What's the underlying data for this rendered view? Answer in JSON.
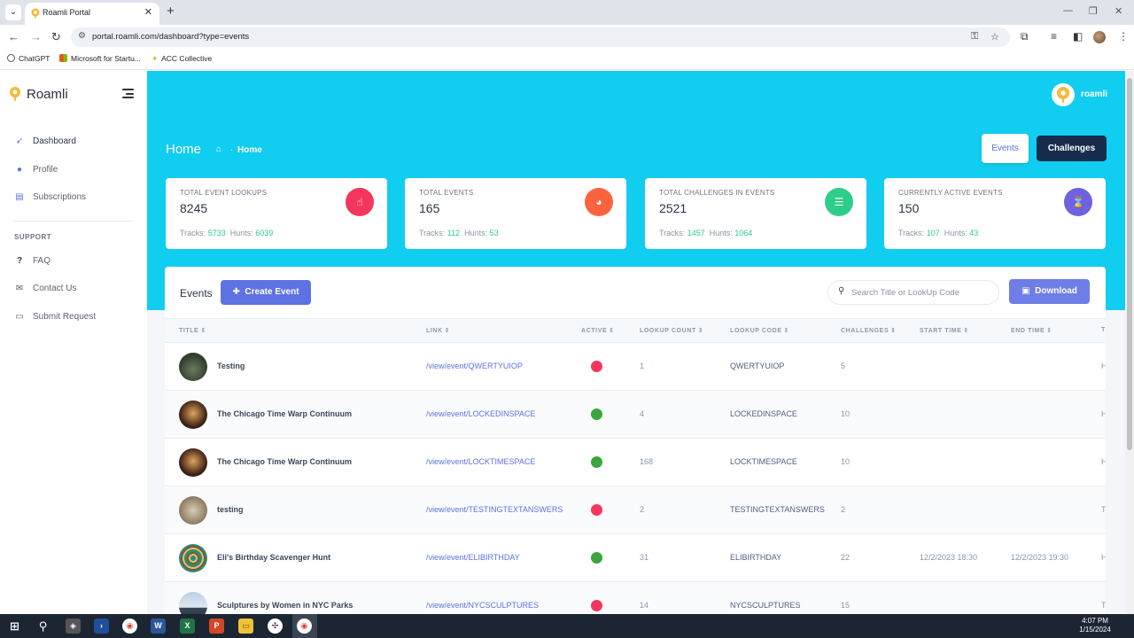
{
  "browser": {
    "tab_title": "Roamli Portal",
    "url": "portal.roamli.com/dashboard?type=events",
    "bookmarks": [
      "ChatGPT",
      "Microsoft for Startu...",
      "ACC Collective"
    ]
  },
  "sidebar": {
    "brand": "Roamli",
    "items": [
      {
        "label": "Dashboard",
        "icon": "rocket-icon"
      },
      {
        "label": "Profile",
        "icon": "user-icon"
      },
      {
        "label": "Subscriptions",
        "icon": "store-icon"
      }
    ],
    "support_heading": "SUPPORT",
    "support_items": [
      {
        "label": "FAQ",
        "icon": "question-icon"
      },
      {
        "label": "Contact Us",
        "icon": "envelope-icon"
      },
      {
        "label": "Submit Request",
        "icon": "chat-icon"
      }
    ]
  },
  "header": {
    "user_name": "roamli",
    "title": "Home",
    "breadcrumb": "Home",
    "events_button": "Events",
    "challenges_button": "Challenges"
  },
  "stats": [
    {
      "label": "TOTAL EVENT LOOKUPS",
      "value": "8245",
      "tracks_label": "Tracks:",
      "tracks": "5733",
      "hunts_label": "Hunts:",
      "hunts": "6039",
      "color": "#f5365c",
      "icon": "hand-pointer-icon"
    },
    {
      "label": "TOTAL EVENTS",
      "value": "165",
      "tracks_label": "Tracks:",
      "tracks": "112",
      "hunts_label": "Hunts:",
      "hunts": "53",
      "color": "#fb6340",
      "icon": "pie-chart-icon"
    },
    {
      "label": "TOTAL CHALLENGES IN EVENTS",
      "value": "2521",
      "tracks_label": "Tracks:",
      "tracks": "1457",
      "hunts_label": "Hunts:",
      "hunts": "1064",
      "color": "#2dce89",
      "icon": "list-icon"
    },
    {
      "label": "CURRENTLY ACTIVE EVENTS",
      "value": "150",
      "tracks_label": "Tracks:",
      "tracks": "107",
      "hunts_label": "Hunts:",
      "hunts": "43",
      "color": "#6e62e0",
      "icon": "hourglass-icon"
    }
  ],
  "events": {
    "title": "Events",
    "create_button": "Create Event",
    "search_placeholder": "Search Title or LookUp Code",
    "download_button": "Download",
    "columns": [
      "TITLE",
      "LINK",
      "ACTIVE",
      "LOOKUP COUNT",
      "LOOKUP CODE",
      "CHALLENGES",
      "START TIME",
      "END TIME",
      "T"
    ],
    "rows": [
      {
        "title": "Testing",
        "link": "/view/event/QWERTYUIOP",
        "active": false,
        "lookup_count": "1",
        "lookup_code": "QWERTYUIOP",
        "challenges": "5",
        "start": "",
        "end": "",
        "trail": "H"
      },
      {
        "title": "The Chicago Time Warp Continuum",
        "link": "/view/event/LOCKEDINSPACE",
        "active": true,
        "lookup_count": "4",
        "lookup_code": "LOCKEDINSPACE",
        "challenges": "10",
        "start": "",
        "end": "",
        "trail": "H"
      },
      {
        "title": "The Chicago Time Warp Continuum",
        "link": "/view/event/LOCKTIMESPACE",
        "active": true,
        "lookup_count": "168",
        "lookup_code": "LOCKTIMESPACE",
        "challenges": "10",
        "start": "",
        "end": "",
        "trail": "H"
      },
      {
        "title": "testing",
        "link": "/view/event/TESTINGTEXTANSWERS",
        "active": false,
        "lookup_count": "2",
        "lookup_code": "TESTINGTEXTANSWERS",
        "challenges": "2",
        "start": "",
        "end": "",
        "trail": "T"
      },
      {
        "title": "Eli's Birthday Scavenger Hunt",
        "link": "/view/event/ELIBIRTHDAY",
        "active": true,
        "lookup_count": "31",
        "lookup_code": "ELIBIRTHDAY",
        "challenges": "22",
        "start": "12/2/2023 18:30",
        "end": "12/2/2023 19:30",
        "trail": "H"
      },
      {
        "title": "Sculptures by Women in NYC Parks",
        "link": "/view/event/NYCSCULPTURES",
        "active": false,
        "lookup_count": "14",
        "lookup_code": "NYCSCULPTURES",
        "challenges": "15",
        "start": "",
        "end": "",
        "trail": "T"
      }
    ]
  },
  "taskbar": {
    "time": "4:07 PM",
    "date": "1/15/2024"
  },
  "colors": {
    "accent": "#11cdef",
    "primary": "#5e72e4",
    "dark_button": "#172b4d",
    "active_on": "#2dce89",
    "active_off": "#f5365c"
  }
}
